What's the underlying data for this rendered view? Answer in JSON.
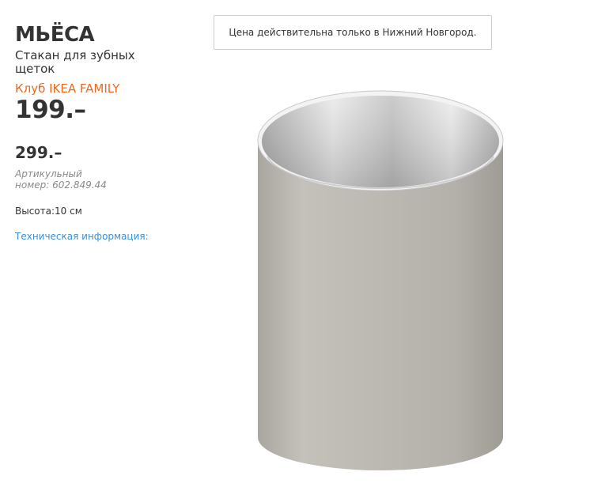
{
  "product": {
    "name": "МЬЁСА",
    "type": "Стакан для зубных щеток",
    "family_label": "Клуб IKEA FAMILY",
    "family_price": "199.–",
    "regular_price": "299.–",
    "article": "Артикульный номер: 602.849.44",
    "height": "Высота:10 см",
    "tech_info_link": "Техническая информация:"
  },
  "notice": {
    "text": "Цена действительна только в Нижний Новгород."
  },
  "image": {
    "icon": "toothbrush-holder-cup",
    "colors": {
      "body": "#bdb9b3",
      "inner": "#d6d6d6",
      "rim": "#f2f2f2"
    }
  },
  "colors": {
    "family_accent": "#e96a1f",
    "link": "#3b8fd6",
    "text": "#333333",
    "muted": "#8a8a8a"
  }
}
